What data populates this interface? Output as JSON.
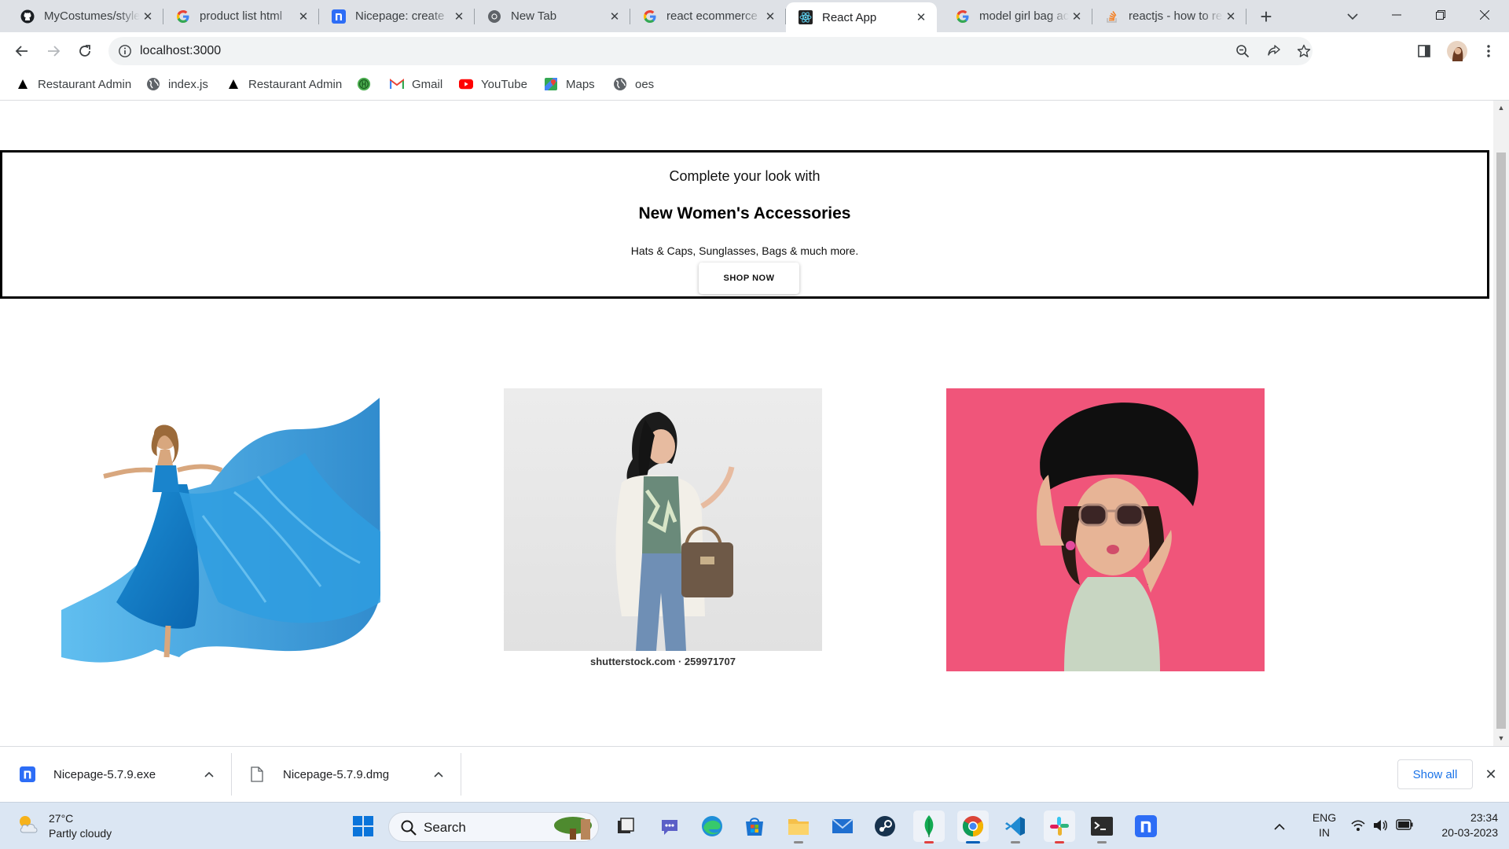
{
  "browser": {
    "tabs": [
      {
        "title": "MyCostumes/style",
        "favicon": "github-icon"
      },
      {
        "title": "product list html",
        "favicon": "google-icon"
      },
      {
        "title": "Nicepage: create",
        "favicon": "nicepage-icon"
      },
      {
        "title": "New Tab",
        "favicon": "chrome-icon"
      },
      {
        "title": "react ecommerce",
        "favicon": "google-icon"
      },
      {
        "title": "React App",
        "favicon": "react-icon",
        "active": true
      },
      {
        "title": "model girl bag ac",
        "favicon": "google-icon"
      },
      {
        "title": "reactjs - how to re",
        "favicon": "stackoverflow-icon"
      }
    ],
    "url": "localhost:3000",
    "bookmarks": [
      {
        "label": "Restaurant Admin",
        "icon": "triangle-icon"
      },
      {
        "label": "index.js",
        "icon": "globe-icon"
      },
      {
        "label": "Restaurant Admin",
        "icon": "triangle-icon"
      },
      {
        "label": "",
        "icon": "green-circle-icon"
      },
      {
        "label": "Gmail",
        "icon": "gmail-icon"
      },
      {
        "label": "YouTube",
        "icon": "youtube-icon"
      },
      {
        "label": "Maps",
        "icon": "maps-icon"
      },
      {
        "label": "oes",
        "icon": "globe-icon"
      }
    ]
  },
  "page": {
    "promo": {
      "subtitle": "Complete your look with",
      "title": "New Women's Accessories",
      "description": "Hats & Caps, Sunglasses, Bags & much more.",
      "button": "SHOP NOW"
    },
    "products": [
      {
        "image": "woman in flowing blue gown"
      },
      {
        "image": "woman in white coat holding brown handbag",
        "caption": "shutterstock.com · 259971707"
      },
      {
        "image": "woman in black hat and sunglasses on pink background"
      }
    ]
  },
  "downloads": {
    "items": [
      {
        "name": "Nicepage-5.7.9.exe",
        "icon": "nicepage-icon"
      },
      {
        "name": "Nicepage-5.7.9.dmg",
        "icon": "file-icon"
      }
    ],
    "show_all": "Show all"
  },
  "taskbar": {
    "weather": {
      "temp": "27°C",
      "condition": "Partly cloudy"
    },
    "search": "Search",
    "lang": {
      "line1": "ENG",
      "line2": "IN"
    },
    "clock": {
      "time": "23:34",
      "date": "20-03-2023"
    }
  },
  "colors": {
    "accent": "#1a73e8",
    "promo_border": "#000000",
    "hat_bg": "#f0557a",
    "taskbar": "#dbe6f3"
  }
}
